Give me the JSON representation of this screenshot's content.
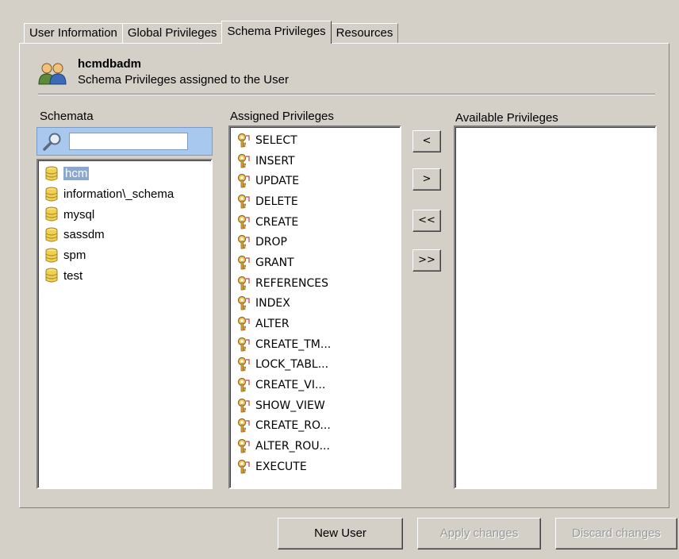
{
  "tabs": [
    {
      "label": "User Information"
    },
    {
      "label": "Global Privileges"
    },
    {
      "label": "Schema Privileges"
    },
    {
      "label": "Resources"
    }
  ],
  "user": {
    "name": "hcmdbadm",
    "subtitle": "Schema Privileges assigned to the User"
  },
  "schemata": {
    "label": "Schemata",
    "search_value": "",
    "items": [
      {
        "label": "hcm"
      },
      {
        "label": "information\\_schema"
      },
      {
        "label": "mysql"
      },
      {
        "label": "sassdm"
      },
      {
        "label": "spm"
      },
      {
        "label": "test"
      }
    ]
  },
  "assigned": {
    "label": "Assigned Privileges",
    "items": [
      {
        "label": "SELECT"
      },
      {
        "label": "INSERT"
      },
      {
        "label": "UPDATE"
      },
      {
        "label": "DELETE"
      },
      {
        "label": "CREATE"
      },
      {
        "label": "DROP"
      },
      {
        "label": "GRANT"
      },
      {
        "label": "REFERENCES"
      },
      {
        "label": "INDEX"
      },
      {
        "label": "ALTER"
      },
      {
        "label": "CREATE_TM..."
      },
      {
        "label": "LOCK_TABL..."
      },
      {
        "label": "CREATE_VI..."
      },
      {
        "label": "SHOW_VIEW"
      },
      {
        "label": "CREATE_RO..."
      },
      {
        "label": "ALTER_ROU..."
      },
      {
        "label": "EXECUTE"
      }
    ]
  },
  "available": {
    "label": "Available Privileges"
  },
  "move_buttons": {
    "move_left": "<",
    "move_right": ">",
    "move_all_left": "<<",
    "move_all_right": ">>"
  },
  "footer": {
    "new_user": "New User",
    "apply": "Apply changes",
    "discard": "Discard changes"
  },
  "colors": {
    "window_bg": "#d4d0c8",
    "selection": "#8da8cf",
    "search_bar": "#a8c8ee"
  }
}
